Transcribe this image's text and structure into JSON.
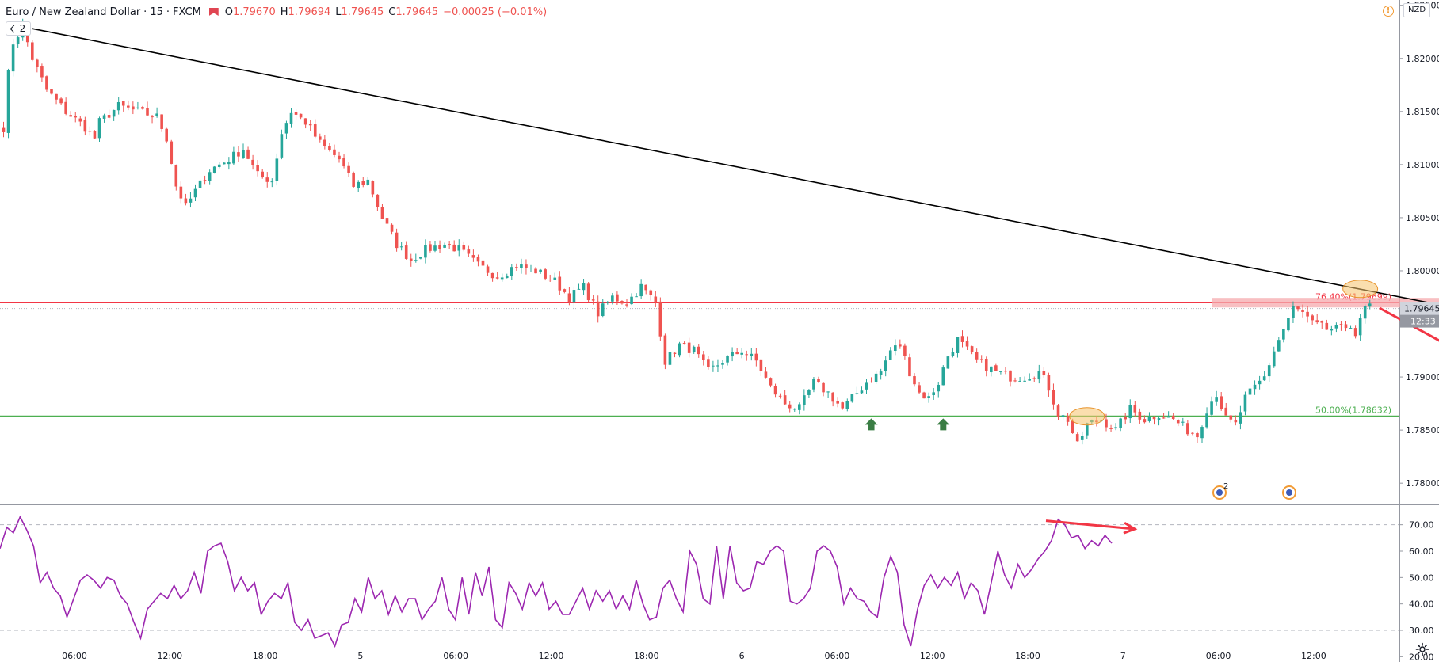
{
  "header": {
    "symbol": "Euro / New Zealand Dollar",
    "interval": "15",
    "source": "FXCM",
    "separator": "·",
    "ohlc": [
      {
        "key": "O",
        "value": "1.79670"
      },
      {
        "key": "H",
        "value": "1.79694"
      },
      {
        "key": "L",
        "value": "1.79645"
      },
      {
        "key": "C",
        "value": "1.79645"
      }
    ],
    "change": "−0.00025 (−0.01%)",
    "indicator_count": "2",
    "currency": "NZD",
    "alert_icon": "warning-icon"
  },
  "colors": {
    "bull": "#26a69a",
    "bear": "#ef5350",
    "trendline": "#000000",
    "fib_764": "#f23645",
    "fib_50": "#4caf50",
    "rsi": "#9c27b0",
    "annotation_arrow": "#f23645",
    "highlight": "#f5c26b",
    "support_arrow": "#3a7d44"
  },
  "price_labels": {
    "current": "1.79645",
    "countdown": "12:33"
  },
  "events": [
    {
      "icon": "economic-event-icon",
      "count": "2"
    },
    {
      "icon": "economic-event-icon",
      "count": ""
    }
  ],
  "settings_icon": "gear-icon",
  "chart_data": [
    {
      "type": "candlestick",
      "title": "Euro / New Zealand Dollar · 15 · FXCM",
      "y_axis_ticks": [
        "1.82500",
        "1.82000",
        "1.81500",
        "1.81000",
        "1.80500",
        "1.80000",
        "1.79500",
        "1.79000",
        "1.78500",
        "1.78000"
      ],
      "ylim": [
        1.778,
        1.8255
      ],
      "x_axis_ticks": [
        "06:00",
        "12:00",
        "18:00",
        "5",
        "06:00",
        "12:00",
        "18:00",
        "6",
        "06:00",
        "12:00",
        "18:00",
        "7",
        "06:00",
        "12:00"
      ],
      "price_path": [
        {
          "t": 0,
          "p": 1.8135
        },
        {
          "t": 1,
          "p": 1.8185
        },
        {
          "t": 2,
          "p": 1.8215
        },
        {
          "t": 4,
          "p": 1.823
        },
        {
          "t": 6,
          "p": 1.82
        },
        {
          "t": 9,
          "p": 1.817
        },
        {
          "t": 13,
          "p": 1.815
        },
        {
          "t": 17,
          "p": 1.8135
        },
        {
          "t": 19,
          "p": 1.8125
        },
        {
          "t": 20,
          "p": 1.814
        },
        {
          "t": 24,
          "p": 1.8155
        },
        {
          "t": 28,
          "p": 1.815
        },
        {
          "t": 32,
          "p": 1.8145
        },
        {
          "t": 34,
          "p": 1.8125
        },
        {
          "t": 36,
          "p": 1.808
        },
        {
          "t": 38,
          "p": 1.806
        },
        {
          "t": 40,
          "p": 1.8075
        },
        {
          "t": 43,
          "p": 1.8095
        },
        {
          "t": 47,
          "p": 1.8105
        },
        {
          "t": 50,
          "p": 1.8115
        },
        {
          "t": 53,
          "p": 1.809
        },
        {
          "t": 56,
          "p": 1.8085
        },
        {
          "t": 58,
          "p": 1.813
        },
        {
          "t": 60,
          "p": 1.815
        },
        {
          "t": 63,
          "p": 1.814
        },
        {
          "t": 66,
          "p": 1.812
        },
        {
          "t": 70,
          "p": 1.8105
        },
        {
          "t": 73,
          "p": 1.808
        },
        {
          "t": 76,
          "p": 1.8085
        },
        {
          "t": 79,
          "p": 1.805
        },
        {
          "t": 82,
          "p": 1.8025
        },
        {
          "t": 85,
          "p": 1.801
        },
        {
          "t": 88,
          "p": 1.802
        },
        {
          "t": 92,
          "p": 1.8025
        },
        {
          "t": 95,
          "p": 1.802
        },
        {
          "t": 99,
          "p": 1.8005
        },
        {
          "t": 103,
          "p": 1.7995
        },
        {
          "t": 107,
          "p": 1.8005
        },
        {
          "t": 111,
          "p": 1.8
        },
        {
          "t": 115,
          "p": 1.799
        },
        {
          "t": 118,
          "p": 1.7975
        },
        {
          "t": 121,
          "p": 1.7985
        },
        {
          "t": 124,
          "p": 1.796
        },
        {
          "t": 127,
          "p": 1.7975
        },
        {
          "t": 130,
          "p": 1.797
        },
        {
          "t": 133,
          "p": 1.7985
        },
        {
          "t": 136,
          "p": 1.797
        },
        {
          "t": 138,
          "p": 1.7915
        },
        {
          "t": 141,
          "p": 1.793
        },
        {
          "t": 144,
          "p": 1.7925
        },
        {
          "t": 147,
          "p": 1.7905
        },
        {
          "t": 150,
          "p": 1.7915
        },
        {
          "t": 154,
          "p": 1.7925
        },
        {
          "t": 157,
          "p": 1.7915
        },
        {
          "t": 160,
          "p": 1.789
        },
        {
          "t": 163,
          "p": 1.7875
        },
        {
          "t": 166,
          "p": 1.787
        },
        {
          "t": 169,
          "p": 1.7895
        },
        {
          "t": 172,
          "p": 1.7885
        },
        {
          "t": 175,
          "p": 1.787
        },
        {
          "t": 177,
          "p": 1.788
        },
        {
          "t": 180,
          "p": 1.7895
        },
        {
          "t": 183,
          "p": 1.7905
        },
        {
          "t": 185,
          "p": 1.7925
        },
        {
          "t": 187,
          "p": 1.793
        },
        {
          "t": 189,
          "p": 1.7905
        },
        {
          "t": 191,
          "p": 1.7885
        },
        {
          "t": 193,
          "p": 1.788
        },
        {
          "t": 195,
          "p": 1.7895
        },
        {
          "t": 197,
          "p": 1.792
        },
        {
          "t": 199,
          "p": 1.7935
        },
        {
          "t": 201,
          "p": 1.7925
        },
        {
          "t": 203,
          "p": 1.7915
        },
        {
          "t": 207,
          "p": 1.7905
        },
        {
          "t": 210,
          "p": 1.79
        },
        {
          "t": 213,
          "p": 1.79
        },
        {
          "t": 216,
          "p": 1.7905
        },
        {
          "t": 218,
          "p": 1.789
        },
        {
          "t": 220,
          "p": 1.7865
        },
        {
          "t": 222,
          "p": 1.786
        },
        {
          "t": 224,
          "p": 1.7835
        },
        {
          "t": 226,
          "p": 1.7855
        },
        {
          "t": 229,
          "p": 1.786
        },
        {
          "t": 232,
          "p": 1.785
        },
        {
          "t": 235,
          "p": 1.787
        },
        {
          "t": 238,
          "p": 1.786
        },
        {
          "t": 241,
          "p": 1.7865
        },
        {
          "t": 244,
          "p": 1.786
        },
        {
          "t": 247,
          "p": 1.785
        },
        {
          "t": 249,
          "p": 1.7845
        },
        {
          "t": 251,
          "p": 1.787
        },
        {
          "t": 253,
          "p": 1.7885
        },
        {
          "t": 255,
          "p": 1.786
        },
        {
          "t": 257,
          "p": 1.7855
        },
        {
          "t": 259,
          "p": 1.788
        },
        {
          "t": 261,
          "p": 1.789
        },
        {
          "t": 263,
          "p": 1.79
        },
        {
          "t": 265,
          "p": 1.7925
        },
        {
          "t": 267,
          "p": 1.7945
        },
        {
          "t": 269,
          "p": 1.7965
        },
        {
          "t": 271,
          "p": 1.796
        },
        {
          "t": 273,
          "p": 1.795
        },
        {
          "t": 276,
          "p": 1.7945
        },
        {
          "t": 279,
          "p": 1.7945
        },
        {
          "t": 281,
          "p": 1.795
        },
        {
          "t": 282,
          "p": 1.794
        },
        {
          "t": 284,
          "p": 1.7965
        },
        {
          "t": 285,
          "p": 1.7967
        }
      ],
      "trendline": {
        "from": {
          "t": 6,
          "p": 1.8228
        },
        "to": {
          "t": 356,
          "p": 1.7918
        }
      },
      "fibonacci_levels": [
        {
          "label": "76.40%(1.79699)",
          "price": 1.79699
        },
        {
          "label": "50.00%(1.78632)",
          "price": 1.78632
        }
      ],
      "annotations": {
        "resistance_zone": {
          "t_start": 252,
          "t_end": 303,
          "p_low": 1.79655,
          "p_high": 1.79745
        },
        "highlight_ellipses": [
          {
            "t": 283,
            "p": 1.7983
          },
          {
            "t": 226,
            "p": 1.7863
          }
        ],
        "support_arrows": [
          {
            "t": 181,
            "p": 1.7855
          },
          {
            "t": 196,
            "p": 1.7855
          }
        ],
        "projection_arrow": {
          "from": {
            "t": 287,
            "p": 1.7965
          },
          "to": {
            "t": 350,
            "p": 1.781
          }
        }
      }
    },
    {
      "type": "line",
      "title": "",
      "series": [
        {
          "name": "",
          "values": [
            61,
            69,
            67,
            73,
            68,
            62,
            48,
            52,
            46,
            43,
            35,
            42,
            49,
            51,
            49,
            46,
            50,
            49,
            43,
            40,
            33,
            27,
            38,
            41,
            44,
            42,
            47,
            42,
            45,
            52,
            44,
            60,
            62,
            63,
            56,
            45,
            50,
            45,
            48,
            36,
            41,
            44,
            42,
            48,
            33,
            30,
            34,
            27,
            28,
            29,
            24,
            32,
            33,
            42,
            37,
            50,
            42,
            45,
            36,
            43,
            37,
            42,
            42,
            34,
            38,
            41,
            50,
            38,
            34,
            50,
            36,
            52,
            43,
            54,
            34,
            31,
            48,
            44,
            38,
            48,
            43,
            48,
            38,
            41,
            36,
            36,
            41,
            46,
            38,
            45,
            41,
            45,
            38,
            43,
            38,
            49,
            40,
            34,
            35,
            46,
            49,
            42,
            37,
            60,
            55,
            42,
            40,
            62,
            42,
            62,
            48,
            45,
            46,
            56,
            55,
            60,
            62,
            60,
            41,
            40,
            42,
            46,
            60,
            62,
            60,
            54,
            40,
            46,
            42,
            41,
            37,
            35,
            50,
            58,
            52,
            32,
            24,
            38,
            47,
            51,
            46,
            50,
            47,
            52,
            42,
            48,
            45,
            36,
            48,
            60,
            51,
            46,
            55,
            50,
            53,
            57,
            60,
            64,
            72,
            70,
            65,
            66,
            61,
            64,
            62,
            66,
            63
          ]
        }
      ],
      "y_axis_ticks": [
        "70.00",
        "60.00",
        "50.00",
        "40.00",
        "30.00",
        "20.00"
      ],
      "ylim": [
        18,
        78
      ],
      "levels": [
        70,
        30
      ],
      "annotation_arrow": {
        "from": {
          "i": 144,
          "v": 71.5
        },
        "to": {
          "i": 154,
          "v": 69
        }
      }
    }
  ]
}
